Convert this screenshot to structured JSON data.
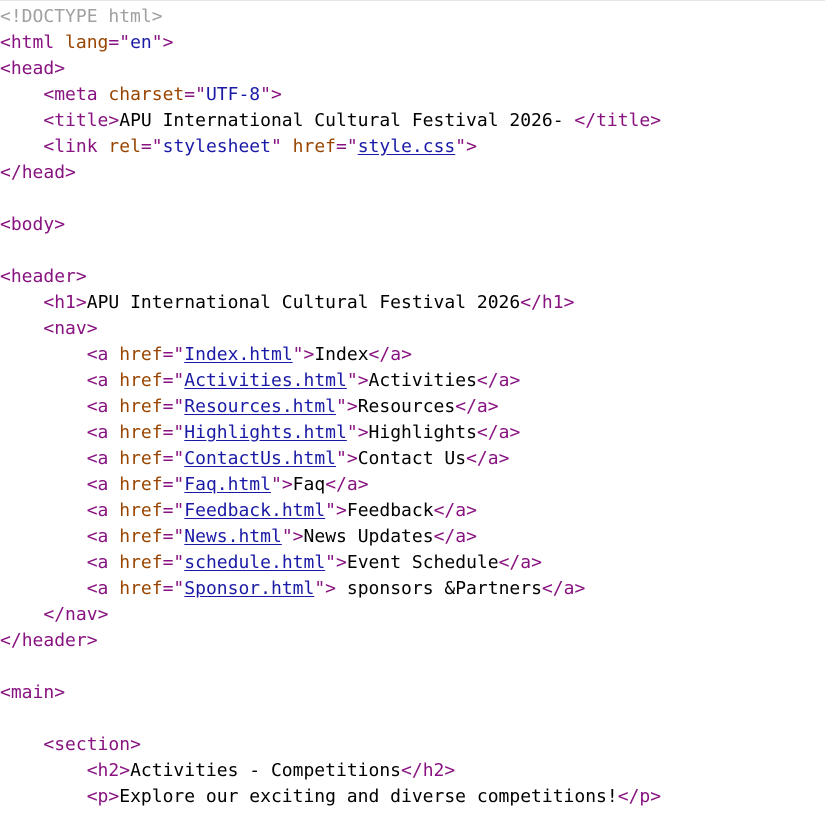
{
  "source_lines": [
    {
      "indent": 0,
      "kind": "doctype",
      "text": "<!DOCTYPE html>"
    },
    {
      "indent": 0,
      "kind": "open",
      "tag": "html",
      "attrs": [
        {
          "name": "lang",
          "value": "en",
          "link": false
        }
      ]
    },
    {
      "indent": 0,
      "kind": "open",
      "tag": "head"
    },
    {
      "indent": 4,
      "kind": "open",
      "tag": "meta",
      "attrs": [
        {
          "name": "charset",
          "value": "UTF-8",
          "link": false
        }
      ]
    },
    {
      "indent": 4,
      "kind": "element",
      "tag": "title",
      "text": "APU International Cultural Festival 2026- "
    },
    {
      "indent": 4,
      "kind": "open",
      "tag": "link",
      "attrs": [
        {
          "name": "rel",
          "value": "stylesheet",
          "link": false
        },
        {
          "name": "href",
          "value": "style.css",
          "link": true
        }
      ]
    },
    {
      "indent": 0,
      "kind": "close",
      "tag": "head"
    },
    {
      "indent": 0,
      "kind": "blank"
    },
    {
      "indent": 0,
      "kind": "open",
      "tag": "body"
    },
    {
      "indent": 0,
      "kind": "blank"
    },
    {
      "indent": 0,
      "kind": "open",
      "tag": "header"
    },
    {
      "indent": 4,
      "kind": "element",
      "tag": "h1",
      "text": "APU International Cultural Festival 2026"
    },
    {
      "indent": 4,
      "kind": "open",
      "tag": "nav"
    },
    {
      "indent": 8,
      "kind": "element",
      "tag": "a",
      "attrs": [
        {
          "name": "href",
          "value": "Index.html",
          "link": true
        }
      ],
      "text": "Index"
    },
    {
      "indent": 8,
      "kind": "element",
      "tag": "a",
      "attrs": [
        {
          "name": "href",
          "value": "Activities.html",
          "link": true
        }
      ],
      "text": "Activities"
    },
    {
      "indent": 8,
      "kind": "element",
      "tag": "a",
      "attrs": [
        {
          "name": "href",
          "value": "Resources.html",
          "link": true
        }
      ],
      "text": "Resources"
    },
    {
      "indent": 8,
      "kind": "element",
      "tag": "a",
      "attrs": [
        {
          "name": "href",
          "value": "Highlights.html",
          "link": true
        }
      ],
      "text": "Highlights"
    },
    {
      "indent": 8,
      "kind": "element",
      "tag": "a",
      "attrs": [
        {
          "name": "href",
          "value": "ContactUs.html",
          "link": true
        }
      ],
      "text": "Contact Us"
    },
    {
      "indent": 8,
      "kind": "element",
      "tag": "a",
      "attrs": [
        {
          "name": "href",
          "value": "Faq.html",
          "link": true
        }
      ],
      "text": "Faq"
    },
    {
      "indent": 8,
      "kind": "element",
      "tag": "a",
      "attrs": [
        {
          "name": "href",
          "value": "Feedback.html",
          "link": true
        }
      ],
      "text": "Feedback"
    },
    {
      "indent": 8,
      "kind": "element",
      "tag": "a",
      "attrs": [
        {
          "name": "href",
          "value": "News.html",
          "link": true
        }
      ],
      "text": "News Updates"
    },
    {
      "indent": 8,
      "kind": "element",
      "tag": "a",
      "attrs": [
        {
          "name": "href",
          "value": "schedule.html",
          "link": true
        }
      ],
      "text": "Event Schedule"
    },
    {
      "indent": 8,
      "kind": "element",
      "tag": "a",
      "attrs": [
        {
          "name": "href",
          "value": "Sponsor.html",
          "link": true
        }
      ],
      "text": " sponsors &Partners"
    },
    {
      "indent": 4,
      "kind": "close",
      "tag": "nav"
    },
    {
      "indent": 0,
      "kind": "close",
      "tag": "header"
    },
    {
      "indent": 0,
      "kind": "blank"
    },
    {
      "indent": 0,
      "kind": "open",
      "tag": "main"
    },
    {
      "indent": 0,
      "kind": "blank"
    },
    {
      "indent": 4,
      "kind": "open",
      "tag": "section"
    },
    {
      "indent": 8,
      "kind": "element",
      "tag": "h2",
      "text": "Activities - Competitions"
    },
    {
      "indent": 8,
      "kind": "element",
      "tag": "p",
      "text": "Explore our exciting and diverse competitions!"
    }
  ],
  "colors": {
    "doctype": "#a0a0a0",
    "tag": "#881280",
    "attribute_name": "#994500",
    "attribute_value": "#1a1aa6",
    "text": "#000000",
    "background": "#ffffff"
  }
}
